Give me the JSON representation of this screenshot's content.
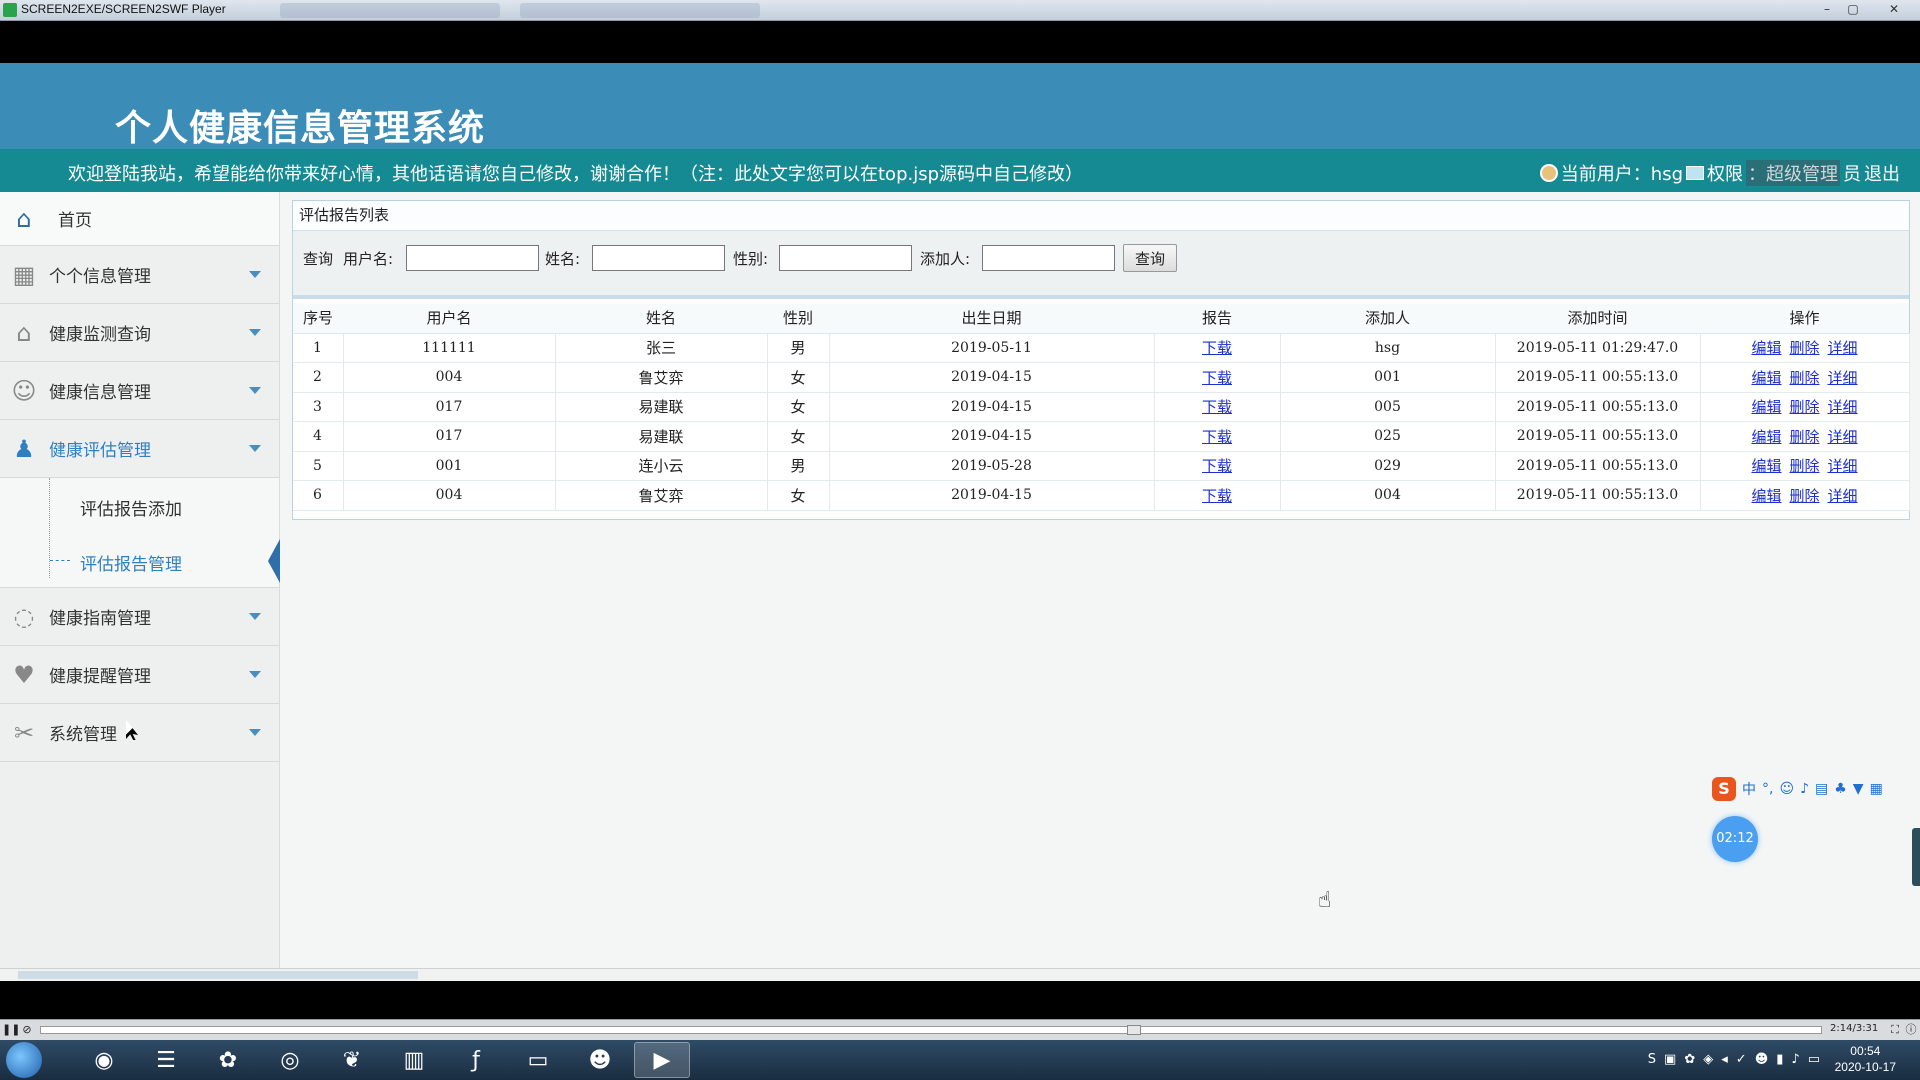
{
  "window": {
    "title": "SCREEN2EXE/SCREEN2SWF Player",
    "minimize": "–",
    "maximize": "▢",
    "close": "✕"
  },
  "header": {
    "system_title": "个人健康信息管理系统",
    "welcome": "欢迎登陆我站，希望能给你带来好心情，其他话语请您自己修改，谢谢合作！（注：此处文字您可以在top.jsp源码中自己修改）",
    "current_user_label": "当前用户：hsg",
    "permission_label": "权限",
    "role_prefix": "：超级管理",
    "role_suffix": "员",
    "logout": "退出"
  },
  "sidebar": {
    "home": "首页",
    "items": [
      {
        "label": "个个信息管理",
        "icon": "grid-icon"
      },
      {
        "label": "健康监测查询",
        "icon": "house-icon"
      },
      {
        "label": "健康信息管理",
        "icon": "user-icon"
      },
      {
        "label": "健康评估管理",
        "icon": "person-icon"
      },
      {
        "label": "健康指南管理",
        "icon": "chat-icon"
      },
      {
        "label": "健康提醒管理",
        "icon": "heart-icon"
      },
      {
        "label": "系统管理",
        "icon": "tools-icon"
      }
    ],
    "submenu": [
      {
        "label": "评估报告添加"
      },
      {
        "label": "评估报告管理"
      }
    ],
    "colors": {
      "active": "#2f7fc1",
      "caret": "#4a8ec0"
    }
  },
  "panel": {
    "title": "评估报告列表",
    "search": {
      "query_label": "查询",
      "username_label": "用户名:",
      "name_label": "姓名:",
      "gender_label": "性别:",
      "adder_label": "添加人:",
      "username_value": "",
      "name_value": "",
      "gender_value": "",
      "adder_value": "",
      "button": "查询"
    },
    "table": {
      "headers": [
        "序号",
        "用户名",
        "姓名",
        "性别",
        "出生日期",
        "报告",
        "添加人",
        "添加时间",
        "操作"
      ],
      "rows": [
        {
          "no": "1",
          "username": "111111",
          "name": "张三",
          "gender": "男",
          "birth": "2019-05-11",
          "report": "下载",
          "adder": "hsg",
          "time": "2019-05-11 01:29:47.0"
        },
        {
          "no": "2",
          "username": "004",
          "name": "鲁艾弈",
          "gender": "女",
          "birth": "2019-04-15",
          "report": "下载",
          "adder": "001",
          "time": "2019-05-11 00:55:13.0"
        },
        {
          "no": "3",
          "username": "017",
          "name": "易建联",
          "gender": "女",
          "birth": "2019-04-15",
          "report": "下载",
          "adder": "005",
          "time": "2019-05-11 00:55:13.0"
        },
        {
          "no": "4",
          "username": "017",
          "name": "易建联",
          "gender": "女",
          "birth": "2019-04-15",
          "report": "下载",
          "adder": "025",
          "time": "2019-05-11 00:55:13.0"
        },
        {
          "no": "5",
          "username": "001",
          "name": "连小云",
          "gender": "男",
          "birth": "2019-05-28",
          "report": "下载",
          "adder": "029",
          "time": "2019-05-11 00:55:13.0"
        },
        {
          "no": "6",
          "username": "004",
          "name": "鲁艾弈",
          "gender": "女",
          "birth": "2019-04-15",
          "report": "下载",
          "adder": "004",
          "time": "2019-05-11 00:55:13.0"
        }
      ],
      "actions": [
        "编辑",
        "删除",
        "详细"
      ]
    }
  },
  "overlay": {
    "ime_lang": "中",
    "timer": "02:12"
  },
  "player": {
    "progress": 0.61,
    "time": "2:14/3:31"
  },
  "taskbar": {
    "clock_time": "00:54",
    "clock_date": "2020-10-17"
  },
  "colors": {
    "banner": "#3c8cb8",
    "welcome_bar": "#158a93",
    "link": "#1d2fd0"
  }
}
